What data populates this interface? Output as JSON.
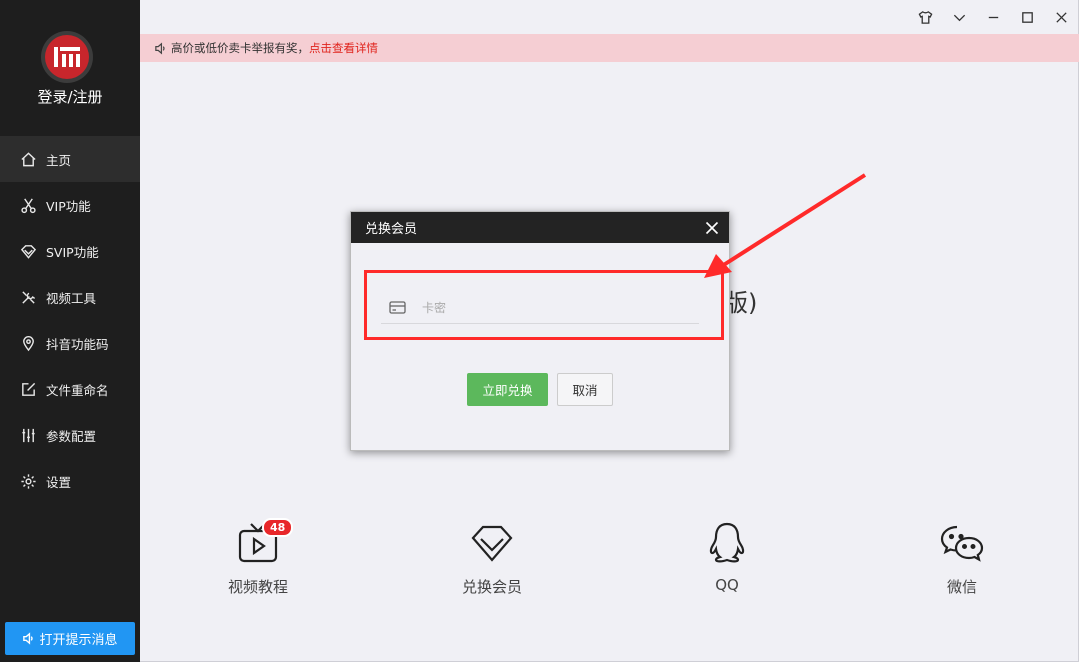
{
  "sidebar": {
    "login_label": "登录/注册",
    "items": [
      {
        "label": "主页",
        "icon": "home-icon"
      },
      {
        "label": "VIP功能",
        "icon": "scissors-icon"
      },
      {
        "label": "SVIP功能",
        "icon": "diamond-icon"
      },
      {
        "label": "视频工具",
        "icon": "tools-icon"
      },
      {
        "label": "抖音功能码",
        "icon": "location-pin-icon"
      },
      {
        "label": "文件重命名",
        "icon": "edit-icon"
      },
      {
        "label": "参数配置",
        "icon": "sliders-icon"
      },
      {
        "label": "设置",
        "icon": "gear-icon"
      }
    ],
    "tip_button": "打开提示消息"
  },
  "notice": {
    "text": "高价或低价卖卡举报有奖，",
    "link": "点击查看详情"
  },
  "background_text": "版)",
  "dialog": {
    "title": "兑换会员",
    "card_placeholder": "卡密",
    "confirm_label": "立即兑换",
    "cancel_label": "取消"
  },
  "bottom": {
    "items": [
      {
        "label": "视频教程",
        "icon": "tv-play-icon",
        "badge": "48"
      },
      {
        "label": "兑换会员",
        "icon": "diamond-icon"
      },
      {
        "label": "QQ",
        "icon": "qq-icon"
      },
      {
        "label": "微信",
        "icon": "wechat-icon"
      }
    ]
  },
  "colors": {
    "sidebar_bg": "#1e1e1e",
    "accent_blue": "#2196f3",
    "confirm_green": "#5cb85c",
    "notice_bg": "#f5ced3",
    "annotation_red": "#ff2a2a"
  }
}
